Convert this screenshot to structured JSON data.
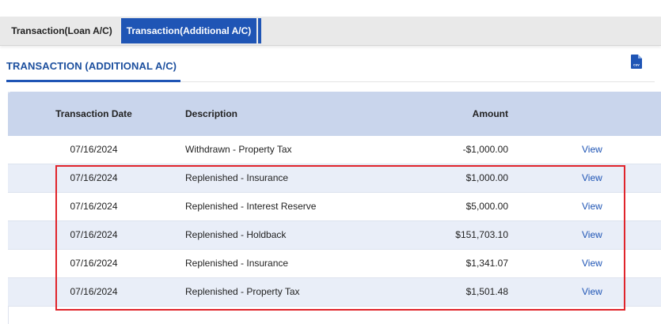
{
  "tabs": [
    {
      "label": "Transaction(Loan A/C)",
      "active": false
    },
    {
      "label": "Transaction(Additional A/C)",
      "active": true
    }
  ],
  "section": {
    "title": "TRANSACTION (ADDITIONAL A/C)",
    "export_icon": "csv-file-icon",
    "export_icon_text": "csv"
  },
  "table": {
    "headers": {
      "date": "Transaction Date",
      "description": "Description",
      "amount": "Amount"
    },
    "rows": [
      {
        "date": "07/16/2024",
        "description": "Withdrawn - Property Tax",
        "amount": "-$1,000.00",
        "action": "View"
      },
      {
        "date": "07/16/2024",
        "description": "Replenished - Insurance",
        "amount": "$1,000.00",
        "action": "View"
      },
      {
        "date": "07/16/2024",
        "description": "Replenished - Interest Reserve",
        "amount": "$5,000.00",
        "action": "View"
      },
      {
        "date": "07/16/2024",
        "description": "Replenished - Holdback",
        "amount": "$151,703.10",
        "action": "View"
      },
      {
        "date": "07/16/2024",
        "description": "Replenished - Insurance",
        "amount": "$1,341.07",
        "action": "View"
      },
      {
        "date": "07/16/2024",
        "description": "Replenished - Property Tax",
        "amount": "$1,501.48",
        "action": "View"
      }
    ]
  },
  "colors": {
    "accent": "#1f55b5",
    "header_bg": "#c9d5ec",
    "row_alt_bg": "#e9eef8",
    "highlight": "#e0242b"
  }
}
